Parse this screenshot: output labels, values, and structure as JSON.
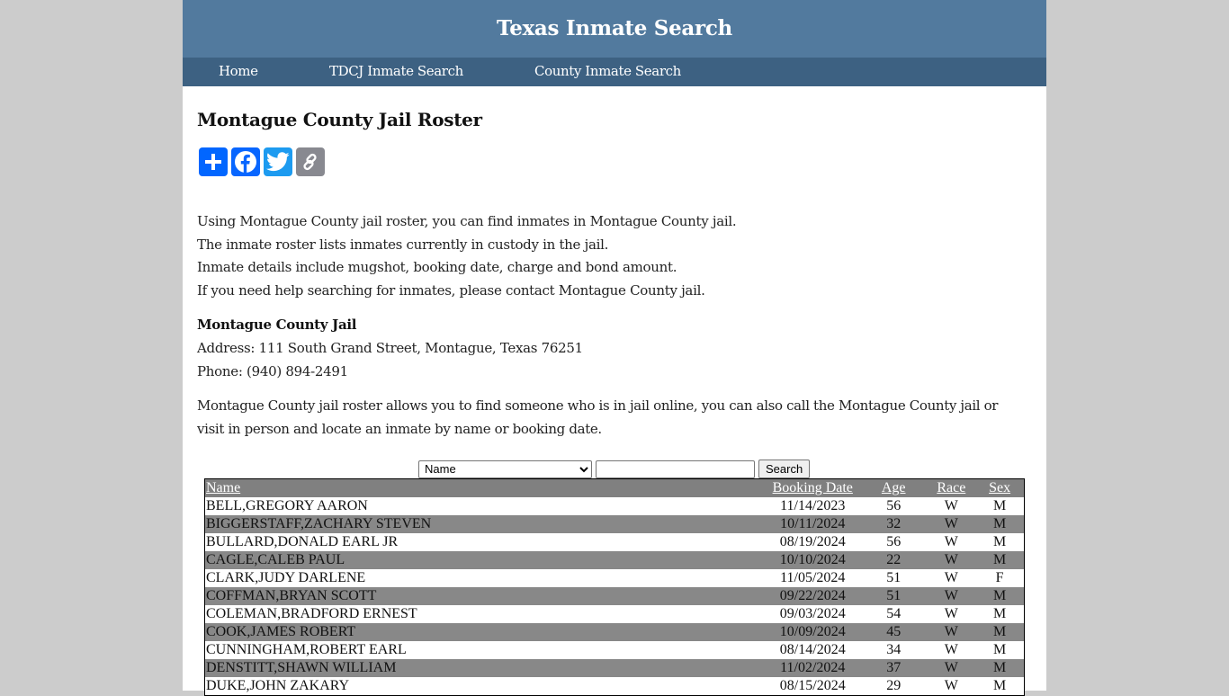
{
  "header": {
    "site_title": "Texas Inmate Search"
  },
  "nav": {
    "items": [
      {
        "label": "Home"
      },
      {
        "label": "TDCJ Inmate Search"
      },
      {
        "label": "County Inmate Search"
      }
    ]
  },
  "main": {
    "title": "Montague County Jail Roster",
    "share_buttons": [
      {
        "icon": "plus-icon",
        "name": "share",
        "color": "#0166ff"
      },
      {
        "icon": "facebook-icon",
        "name": "facebook",
        "color": "#0866ff"
      },
      {
        "icon": "twitter-icon",
        "name": "twitter",
        "color": "#1d9bf0"
      },
      {
        "icon": "link-icon",
        "name": "copy-link",
        "color": "#888990"
      }
    ],
    "intro": [
      "Using Montague County jail roster, you can find inmates in Montague County jail.",
      "The inmate roster lists inmates currently in custody in the jail.",
      "Inmate details include mugshot, booking date, charge and bond amount.",
      "If you need help searching for inmates, please contact Montague County jail."
    ],
    "jail": {
      "name": "Montague County Jail",
      "address": "Address: 111 South Grand Street, Montague, Texas 76251",
      "phone": "Phone: (940) 894-2491"
    },
    "outro": "Montague County jail roster allows you to find someone who is in jail online, you can also call the Montague County jail or visit in person and locate an inmate by name or booking date."
  },
  "search": {
    "field_selected": "Name",
    "query_value": "",
    "button_label": "Search"
  },
  "roster": {
    "columns": [
      "Name",
      "Booking Date",
      "Age",
      "Race",
      "Sex"
    ],
    "rows": [
      {
        "name": "BELL,GREGORY AARON",
        "booking_date": "11/14/2023",
        "age": "56",
        "race": "W",
        "sex": "M"
      },
      {
        "name": "BIGGERSTAFF,ZACHARY STEVEN",
        "booking_date": "10/11/2024",
        "age": "32",
        "race": "W",
        "sex": "M"
      },
      {
        "name": "BULLARD,DONALD EARL JR",
        "booking_date": "08/19/2024",
        "age": "56",
        "race": "W",
        "sex": "M"
      },
      {
        "name": "CAGLE,CALEB PAUL",
        "booking_date": "10/10/2024",
        "age": "22",
        "race": "W",
        "sex": "M"
      },
      {
        "name": "CLARK,JUDY DARLENE",
        "booking_date": "11/05/2024",
        "age": "51",
        "race": "W",
        "sex": "F"
      },
      {
        "name": "COFFMAN,BRYAN SCOTT",
        "booking_date": "09/22/2024",
        "age": "51",
        "race": "W",
        "sex": "M"
      },
      {
        "name": "COLEMAN,BRADFORD ERNEST",
        "booking_date": "09/03/2024",
        "age": "54",
        "race": "W",
        "sex": "M"
      },
      {
        "name": "COOK,JAMES ROBERT",
        "booking_date": "10/09/2024",
        "age": "45",
        "race": "W",
        "sex": "M"
      },
      {
        "name": "CUNNINGHAM,ROBERT EARL",
        "booking_date": "08/14/2024",
        "age": "34",
        "race": "W",
        "sex": "M"
      },
      {
        "name": "DENSTITT,SHAWN WILLIAM",
        "booking_date": "11/02/2024",
        "age": "37",
        "race": "W",
        "sex": "M"
      },
      {
        "name": "DUKE,JOHN ZAKARY",
        "booking_date": "08/15/2024",
        "age": "29",
        "race": "W",
        "sex": "M"
      }
    ]
  }
}
